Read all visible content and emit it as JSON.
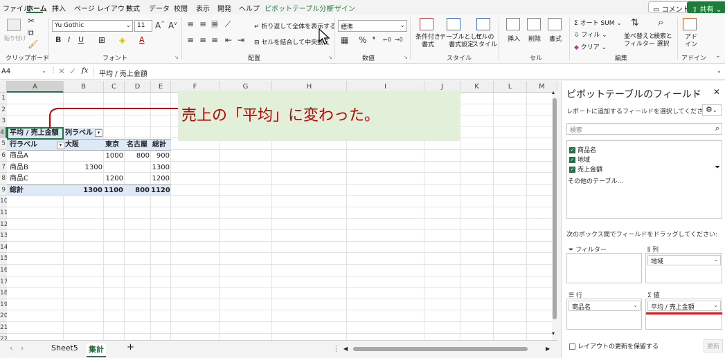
{
  "menu": {
    "tabs": [
      "ファイル",
      "ホーム",
      "挿入",
      "ページ レイアウト",
      "数式",
      "データ",
      "校閲",
      "表示",
      "開発",
      "ヘルプ",
      "ピボットテーブル分析",
      "デザイン"
    ],
    "comment_label": "コメント",
    "share_label": "共有"
  },
  "ribbon": {
    "clipboard": {
      "paste_label": "貼り付け",
      "group": "クリップボード"
    },
    "font": {
      "name": "Yu Gothic",
      "size": "11",
      "group": "フォント"
    },
    "alignment": {
      "wrap": "折り返して全体を表示する",
      "merge": "セルを結合して中央揃え",
      "group": "配置"
    },
    "number": {
      "format": "標準",
      "group": "数値"
    },
    "styles": {
      "conditional": "条件付き\n書式",
      "table": "テーブルとして\n書式設定",
      "cell": "セルの\nスタイル",
      "group": "スタイル"
    },
    "cells": {
      "insert": "挿入",
      "delete": "削除",
      "format": "書式",
      "group": "セル"
    },
    "editing": {
      "autosum": "オート SUM",
      "fill": "フィル",
      "clear": "クリア",
      "sort": "並べ替えと\nフィルター",
      "find": "検索と\n選択",
      "group": "編集"
    },
    "addins": {
      "label": "アド\nイン",
      "group": "アドイン"
    }
  },
  "formula_bar": {
    "name_box": "A4",
    "fx": "fx",
    "content": "平均 / 売上金額"
  },
  "sheet": {
    "columns": [
      "A",
      "B",
      "C",
      "D",
      "E",
      "F",
      "G",
      "H",
      "I",
      "J",
      "K",
      "L",
      "M"
    ],
    "rows": [
      "1",
      "2",
      "3",
      "4",
      "5",
      "6",
      "7",
      "8",
      "9",
      "10",
      "11",
      "12",
      "13",
      "14",
      "15",
      "16",
      "17",
      "18",
      "19",
      "20",
      "21",
      "22"
    ],
    "pivot": {
      "value_header": "平均 / 売上金額",
      "col_labels": "列ラベル",
      "row_labels": "行ラベル",
      "col_items": [
        "大阪",
        "東京",
        "名古屋",
        "総計"
      ],
      "rows": [
        {
          "label": "商品A",
          "values": [
            "",
            "1000",
            "800",
            "900"
          ]
        },
        {
          "label": "商品B",
          "values": [
            "1300",
            "",
            "",
            "1300"
          ]
        },
        {
          "label": "商品C",
          "values": [
            "",
            "1200",
            "",
            "1200"
          ]
        }
      ],
      "total": {
        "label": "総計",
        "values": [
          "1300",
          "1100",
          "800",
          "1120"
        ]
      }
    }
  },
  "callout": {
    "text": "売上の「平均」に変わった。",
    "color": "#c00000"
  },
  "sheet_tabs": {
    "tabs": [
      "Sheet5",
      "集計"
    ],
    "active": "集計",
    "add": "+"
  },
  "pivot_pane": {
    "title": "ピボットテーブルのフィールド",
    "prompt": "レポートに追加するフィールドを選択してください:",
    "search_placeholder": "検索",
    "fields": [
      "商品名",
      "地域",
      "売上金額"
    ],
    "more_tables": "その他のテーブル...",
    "drag_hint": "次のボックス間でフィールドをドラッグしてください:",
    "areas": {
      "filters": {
        "label": "フィルター",
        "items": []
      },
      "columns": {
        "label": "列",
        "items": [
          "地域"
        ]
      },
      "rows": {
        "label": "行",
        "items": [
          "商品名"
        ]
      },
      "values": {
        "label": "値",
        "items": [
          "平均 / 売上金額"
        ]
      }
    },
    "defer_label": "レイアウトの更新を保留する",
    "update_label": "更新"
  },
  "accent_color": "#1e7d3a"
}
